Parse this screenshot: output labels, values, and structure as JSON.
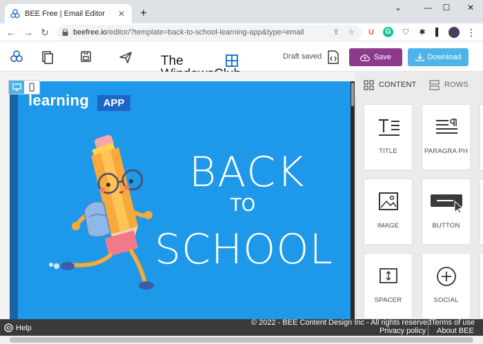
{
  "browser": {
    "tab_title": "BEE Free | Email Editor",
    "close_glyph": "✕",
    "new_tab_glyph": "+",
    "minimize_glyph": "⌄",
    "win_min_glyph": "—",
    "win_max_glyph": "☐",
    "win_close_glyph": "✕",
    "url_host": "beefree.io",
    "url_path": "/editor/?template=back-to-school-learning-app&type=email",
    "back_glyph": "←",
    "forward_glyph": "→",
    "reload_glyph": "↻",
    "share_glyph": "⇪",
    "star_glyph": "☆",
    "ext_u_glyph": "U",
    "ext_g_glyph": "G",
    "ext_puzzle_glyph": "✱",
    "ext_side_glyph": "▌",
    "menu_glyph": "⋮"
  },
  "header": {
    "draft_status": "Draft saved",
    "save_label": "Save",
    "download_label": "Download",
    "watermark_line1": "The",
    "watermark_line2": "WindowsClub"
  },
  "email": {
    "brand_word": "learning",
    "badge": "APP",
    "headline_1": "BACK",
    "headline_2": "TO",
    "headline_3": "SCHOOL"
  },
  "panel": {
    "tab_content": "CONTENT",
    "tab_rows": "ROWS",
    "blocks": [
      {
        "label": "TITLE"
      },
      {
        "label": "PARAGRA PH"
      },
      {
        "label": "IMAGE"
      },
      {
        "label": "BUTTON"
      },
      {
        "label": "SPACER"
      },
      {
        "label": "SOCIAL"
      }
    ]
  },
  "footer": {
    "help": "Help",
    "copyright": "© 2022 - BEE Content Design Inc - All rights reserved",
    "privacy": "Privacy policy",
    "terms": "Terms of use",
    "about": "About BEE"
  },
  "colors": {
    "accent_save": "#8c3a8c",
    "accent_download": "#4db3e8",
    "email_bg": "#1e98e8",
    "badge_bg": "#1d66c8"
  }
}
